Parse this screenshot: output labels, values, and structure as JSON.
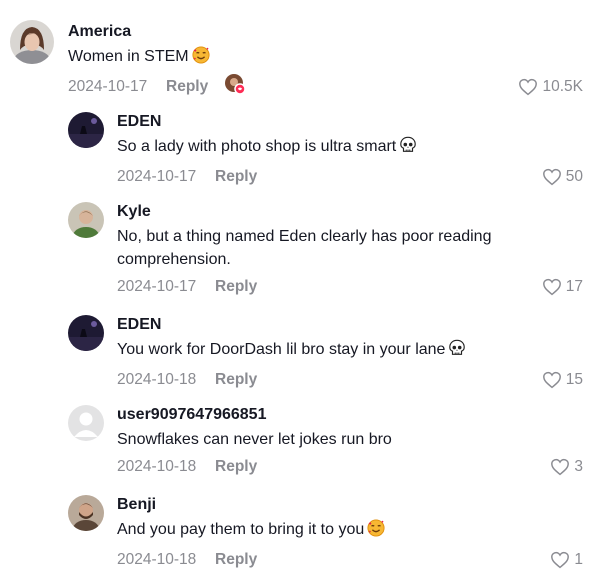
{
  "comments": [
    {
      "username": "America",
      "text": "Women in STEM",
      "date": "2024-10-17",
      "reply": "Reply",
      "likes": "10.5K"
    },
    {
      "username": "EDEN",
      "text": "So a lady with photo shop is ultra smart",
      "date": "2024-10-17",
      "reply": "Reply",
      "likes": "50"
    },
    {
      "username": "Kyle",
      "text": "No, but a thing named Eden clearly has poor reading comprehension.",
      "date": "2024-10-17",
      "reply": "Reply",
      "likes": "17"
    },
    {
      "username": "EDEN",
      "text": "You work for DoorDash lil bro stay in your lane",
      "date": "2024-10-18",
      "reply": "Reply",
      "likes": "15"
    },
    {
      "username": "user9097647966851",
      "text": "Snowflakes can never let jokes run bro",
      "date": "2024-10-18",
      "reply": "Reply",
      "likes": "3"
    },
    {
      "username": "Benji",
      "text": "And you pay them to bring it to you",
      "date": "2024-10-18",
      "reply": "Reply",
      "likes": "1"
    }
  ]
}
